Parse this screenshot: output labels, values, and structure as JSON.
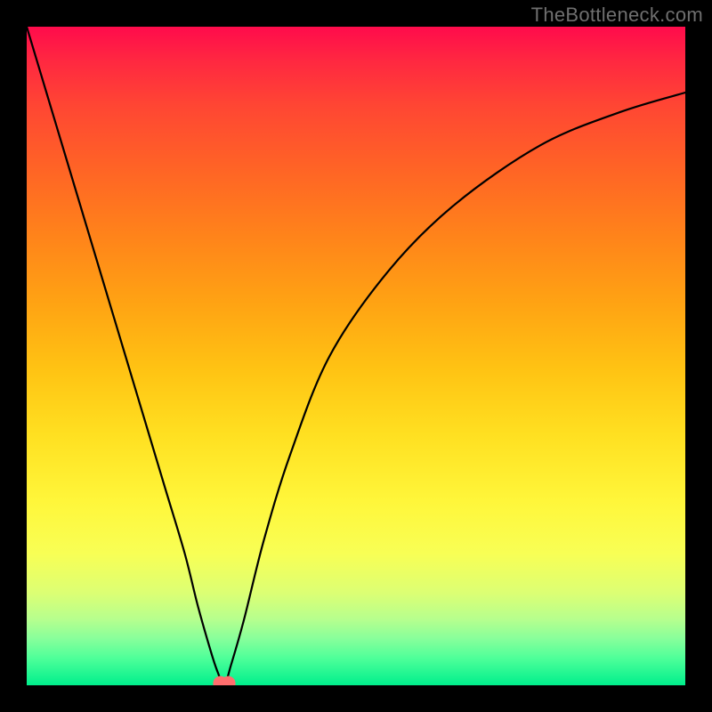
{
  "watermark": "TheBottleneck.com",
  "chart_data": {
    "type": "line",
    "title": "",
    "xlabel": "",
    "ylabel": "",
    "xlim": [
      0,
      100
    ],
    "ylim": [
      0,
      100
    ],
    "grid": false,
    "series": [
      {
        "name": "bottleneck-curve",
        "x": [
          0,
          3,
          6,
          9,
          12,
          15,
          18,
          21,
          24,
          26,
          28,
          29,
          30,
          31,
          33,
          36,
          40,
          46,
          55,
          65,
          78,
          90,
          100
        ],
        "values": [
          100,
          90,
          80,
          70,
          60,
          50,
          40,
          30,
          20,
          12,
          5,
          2,
          0,
          3,
          10,
          22,
          35,
          50,
          63,
          73,
          82,
          87,
          90
        ]
      }
    ],
    "markers": [
      {
        "name": "minimum-dot-left",
        "x": 29.4,
        "y": 0.3,
        "color": "#ff6e6e",
        "r": 1.1
      },
      {
        "name": "minimum-dot-right",
        "x": 30.6,
        "y": 0.3,
        "color": "#ff6e6e",
        "r": 1.1
      }
    ],
    "background": {
      "type": "vertical-gradient",
      "stops": [
        {
          "pos": 0,
          "color": "#ff0b4c"
        },
        {
          "pos": 50,
          "color": "#ffc313"
        },
        {
          "pos": 78,
          "color": "#fff63a"
        },
        {
          "pos": 100,
          "color": "#00ef8c"
        }
      ]
    }
  }
}
